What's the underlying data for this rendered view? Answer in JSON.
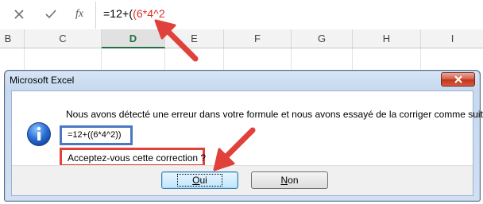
{
  "formula_bar": {
    "cancel_icon": "x-icon",
    "enter_icon": "checkmark-icon",
    "fx_label": "fx",
    "formula_prefix": "=12+(",
    "formula_highlight": "(6*4^2"
  },
  "columns": [
    "B",
    "C",
    "D",
    "E",
    "F",
    "G",
    "H",
    "I"
  ],
  "active_column": "D",
  "dialog": {
    "title": "Microsoft Excel",
    "icon": "info-icon",
    "message": "Nous avons détecté une erreur dans votre formule et nous avons essayé de la corriger comme suit :",
    "suggested_formula": "=12+((6*4^2))",
    "question": "Acceptez-vous cette correction ?",
    "yes_button_underline": "O",
    "yes_button_rest": "ui",
    "no_button_underline": "N",
    "no_button_rest": "on"
  },
  "colors": {
    "highlight_red": "#d93025",
    "annotation_arrow": "#e0413a",
    "annotation_blue": "#4a78c2",
    "active_column_green": "#217346"
  }
}
